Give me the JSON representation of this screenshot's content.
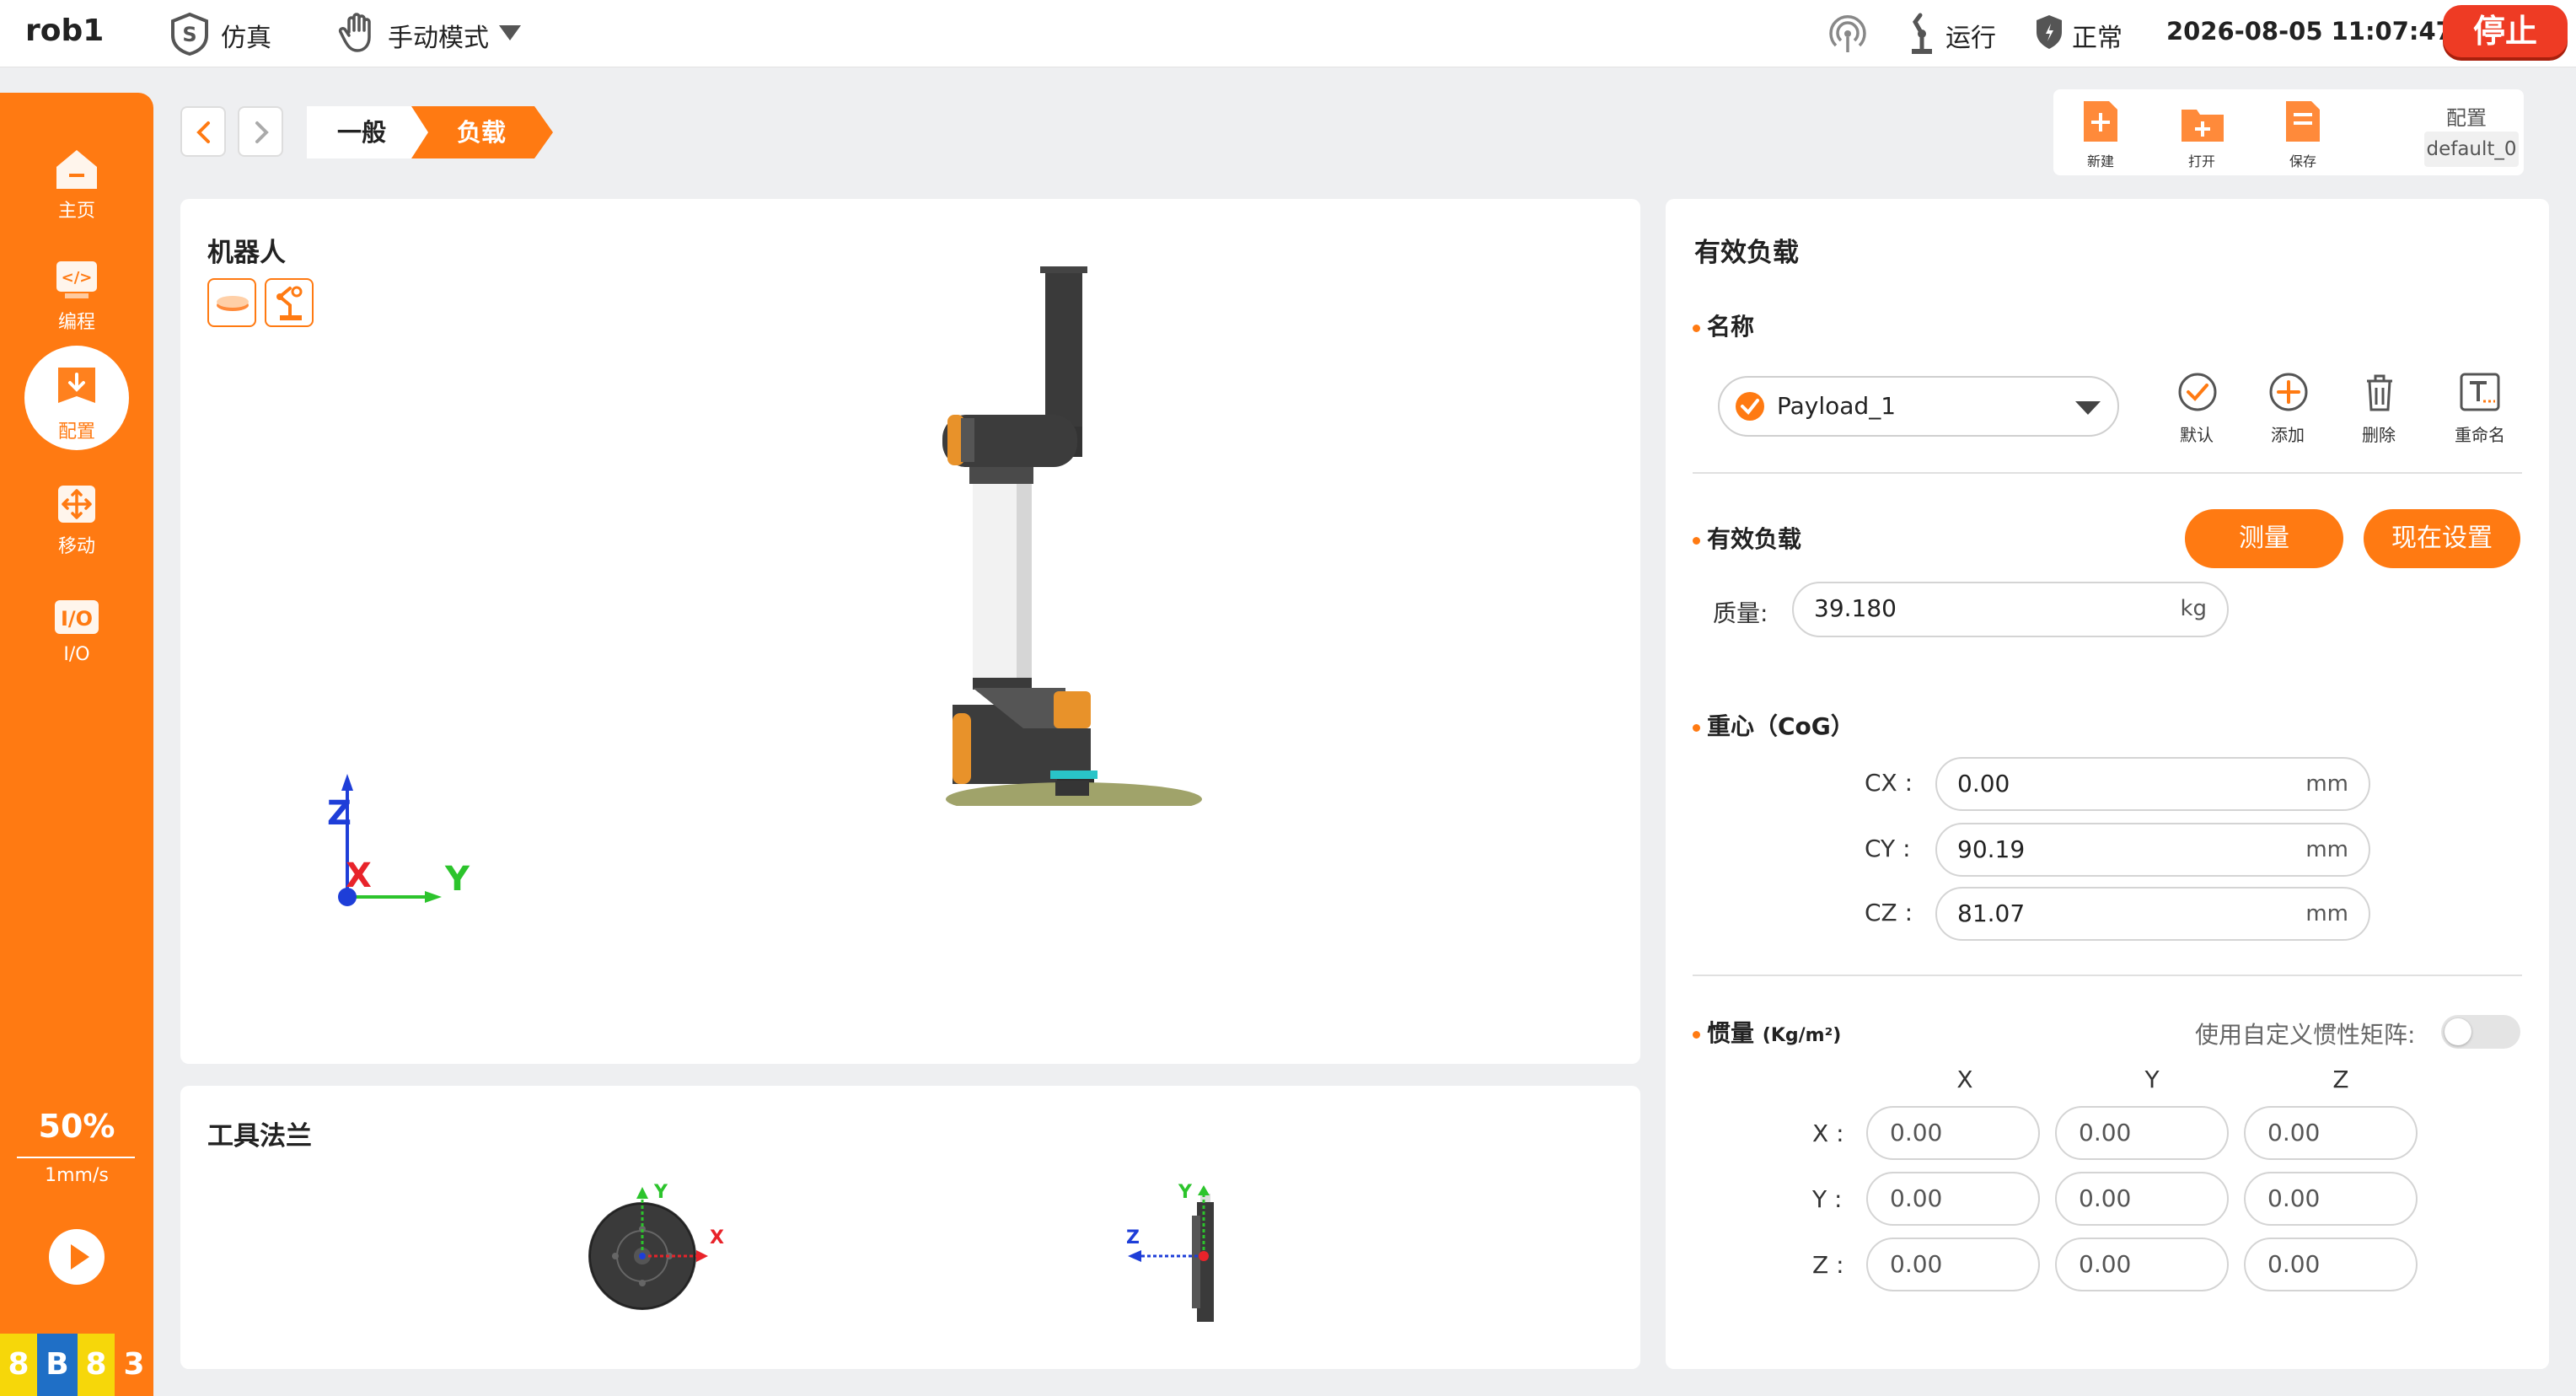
{
  "topbar": {
    "robot_name": "rob1",
    "sim_label": "仿真",
    "mode_label": "手动模式",
    "run_label": "运行",
    "safety_label": "正常",
    "datetime": "2026-08-05 11:07:47",
    "stop_label": "停止"
  },
  "sidebar": {
    "items": [
      {
        "label": "主页",
        "icon": "home-icon"
      },
      {
        "label": "编程",
        "icon": "code-icon"
      },
      {
        "label": "配置",
        "icon": "config-icon"
      },
      {
        "label": "移动",
        "icon": "move-icon"
      },
      {
        "label": "I/O",
        "icon": "io-icon"
      }
    ],
    "speed_percent": "50%",
    "speed_value": "1mm/s",
    "badges": [
      "8",
      "B",
      "8",
      "3"
    ]
  },
  "breadcrumb": {
    "items": [
      "一般",
      "负载"
    ]
  },
  "filebar": {
    "new_label": "新建",
    "open_label": "打开",
    "save_label": "保存",
    "config_label": "配置",
    "config_value": "default_0"
  },
  "robot_panel": {
    "title": "机器人",
    "axes": {
      "z": "Z",
      "x": "X",
      "y": "Y"
    }
  },
  "flange_panel": {
    "title": "工具法兰",
    "front_axes": {
      "y": "Y",
      "x": "X"
    },
    "side_axes": {
      "y": "Y",
      "z": "Z"
    }
  },
  "payload_panel": {
    "title": "有效负载",
    "name_section": "名称",
    "selected_payload": "Payload_1",
    "actions": [
      "默认",
      "添加",
      "删除",
      "重命名"
    ],
    "payload_section": "有效负载",
    "measure_label": "测量",
    "set_now_label": "现在设置",
    "mass_label": "质量:",
    "mass_value": "39.180",
    "mass_unit": "kg",
    "cog_section": "重心（CoG）",
    "cog": [
      {
        "label": "CX :",
        "value": "0.00",
        "unit": "mm"
      },
      {
        "label": "CY :",
        "value": "90.19",
        "unit": "mm"
      },
      {
        "label": "CZ :",
        "value": "81.07",
        "unit": "mm"
      }
    ],
    "inertia_section": "惯量",
    "inertia_unit": "(Kg/m²)",
    "custom_inertia_label": "使用自定义惯性矩阵:",
    "custom_inertia_enabled": false,
    "inertia_cols": [
      "X",
      "Y",
      "Z"
    ],
    "inertia_rows": [
      {
        "label": "X :",
        "values": [
          "0.00",
          "0.00",
          "0.00"
        ]
      },
      {
        "label": "Y :",
        "values": [
          "0.00",
          "0.00",
          "0.00"
        ]
      },
      {
        "label": "Z :",
        "values": [
          "0.00",
          "0.00",
          "0.00"
        ]
      }
    ]
  },
  "colors": {
    "accent": "#ff7a12",
    "stop": "#ee3b24",
    "axis_x": "#e8232a",
    "axis_y": "#2cc42c",
    "axis_z": "#1e3ed8"
  }
}
